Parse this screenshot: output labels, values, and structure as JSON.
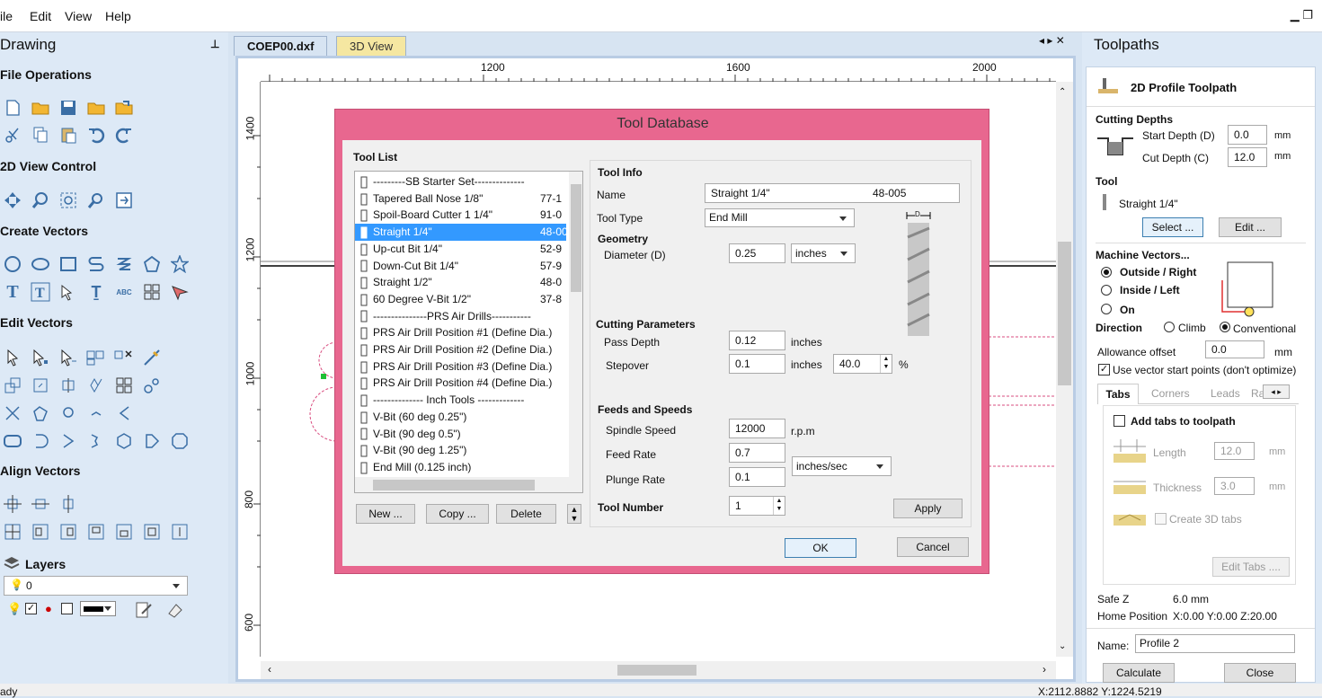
{
  "menu": {
    "file": "ile",
    "edit": "Edit",
    "view": "View",
    "help": "Help"
  },
  "left": {
    "title": "Drawing",
    "pin": "’",
    "file_ops": "File Operations",
    "view_control": "2D View Control",
    "create_vectors": "Create Vectors",
    "edit_vectors": "Edit Vectors",
    "align_vectors": "Align Vectors",
    "layers": "Layers",
    "layer_value": "0"
  },
  "doc": {
    "tab1": "COEP00.dxf",
    "tab2": "3D View",
    "nav": "◂ ▸ ✕",
    "ruler_h": [
      "1200",
      "1600",
      "2000"
    ],
    "ruler_v": [
      "1400",
      "1200",
      "1000",
      "800",
      "600"
    ]
  },
  "dialog": {
    "title": "Tool Database",
    "tool_list_label": "Tool List",
    "tools": [
      {
        "name": "---------SB Starter Set--------------",
        "code": ""
      },
      {
        "name": "Tapered Ball Nose 1/8\"",
        "code": "77-1"
      },
      {
        "name": "Spoil-Board Cutter 1 1/4\"",
        "code": "91-0"
      },
      {
        "name": "Straight 1/4\"",
        "code": "48-00"
      },
      {
        "name": "Up-cut Bit 1/4\"",
        "code": "52-9"
      },
      {
        "name": "Down-Cut Bit 1/4\"",
        "code": "57-9"
      },
      {
        "name": "Straight 1/2\"",
        "code": "48-0"
      },
      {
        "name": "60 Degree V-Bit 1/2\"",
        "code": "37-8"
      },
      {
        "name": "---------------PRS Air Drills-----------",
        "code": ""
      },
      {
        "name": "PRS Air Drill Position #1 (Define Dia.)",
        "code": ""
      },
      {
        "name": "PRS Air Drill Position #2 (Define Dia.)",
        "code": ""
      },
      {
        "name": "PRS Air Drill Position #3 (Define Dia.)",
        "code": ""
      },
      {
        "name": "PRS Air Drill Position #4 (Define Dia.)",
        "code": ""
      },
      {
        "name": "-------------- Inch Tools -------------",
        "code": ""
      },
      {
        "name": "V-Bit (60 deg 0.25\")",
        "code": ""
      },
      {
        "name": "V-Bit (90 deg 0.5\")",
        "code": ""
      },
      {
        "name": "V-Bit (90 deg 1.25\")",
        "code": ""
      },
      {
        "name": "End Mill (0.125 inch)",
        "code": ""
      }
    ],
    "selected_index": 3,
    "btn_new": "New ...",
    "btn_copy": "Copy ...",
    "btn_delete": "Delete",
    "tool_info": "Tool Info",
    "name_label": "Name",
    "name_value": "Straight 1/4\"",
    "name_code": "48-005",
    "tool_type_label": "Tool Type",
    "tool_type_value": "End Mill",
    "geometry": "Geometry",
    "diameter_label": "Diameter (D)",
    "diameter_value": "0.25",
    "units_value": "inches",
    "cutting_params": "Cutting Parameters",
    "pass_depth_label": "Pass Depth",
    "pass_depth_value": "0.12",
    "pass_depth_unit": "inches",
    "stepover_label": "Stepover",
    "stepover_value": "0.1",
    "stepover_unit": "inches",
    "stepover_pct": "40.0",
    "pct": "%",
    "feeds": "Feeds and Speeds",
    "spindle_label": "Spindle Speed",
    "spindle_value": "12000",
    "spindle_unit": "r.p.m",
    "feed_label": "Feed Rate",
    "feed_value": "0.7",
    "plunge_label": "Plunge Rate",
    "plunge_value": "0.1",
    "rate_units": "inches/sec",
    "tool_number_label": "Tool Number",
    "tool_number_value": "1",
    "apply": "Apply",
    "ok": "OK",
    "cancel": "Cancel",
    "diagram_d": "D"
  },
  "right": {
    "title": "Toolpaths",
    "header": "2D Profile Toolpath",
    "cutting_depths": "Cutting Depths",
    "start_depth_label": "Start Depth (D)",
    "start_depth_value": "0.0",
    "cut_depth_label": "Cut Depth (C)",
    "cut_depth_value": "12.0",
    "mm": "mm",
    "tool": "Tool",
    "tool_value": "Straight 1/4\"",
    "select": "Select ...",
    "edit": "Edit ...",
    "machine_vectors": "Machine Vectors...",
    "outside": "Outside / Right",
    "inside": "Inside / Left",
    "on": "On",
    "direction": "Direction",
    "climb": "Climb",
    "conventional": "Conventional",
    "allowance_label": "Allowance offset",
    "allowance_value": "0.0",
    "use_start": "Use vector start points (don't optimize)",
    "tabs": [
      "Tabs",
      "Corners",
      "Leads",
      "Ra"
    ],
    "add_tabs": "Add tabs to toolpath",
    "length_label": "Length",
    "length_value": "12.0",
    "thickness_label": "Thickness",
    "thickness_value": "3.0",
    "create3d": "Create 3D tabs",
    "edit_tabs": "Edit Tabs ....",
    "safez_label": "Safe Z",
    "safez_value": "6.0 mm",
    "home_label": "Home Position",
    "home_value": "X:0.00 Y:0.00 Z:20.00",
    "name_label": "Name:",
    "name_value": "Profile 2",
    "calculate": "Calculate",
    "close": "Close"
  },
  "status": {
    "left": "ady",
    "coords": "X:2112.8882 Y:1224.5219"
  },
  "colors": {
    "dialog_frame": "#e8678f",
    "selection": "#3399ff",
    "panel": "#dde9f6"
  }
}
